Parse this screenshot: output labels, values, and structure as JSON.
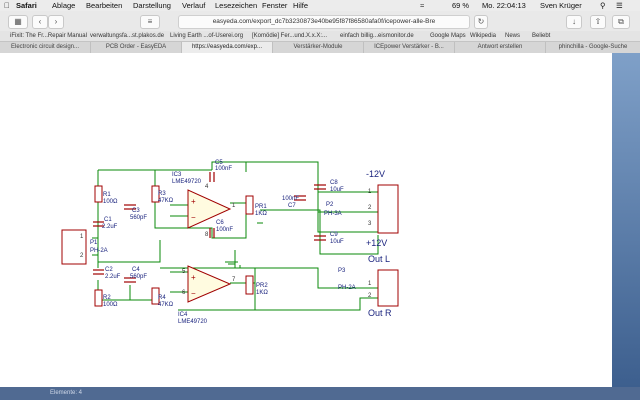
{
  "menubar": {
    "app": "Safari",
    "items": [
      "Ablage",
      "Bearbeiten",
      "Darstellung",
      "Verlauf",
      "Lesezeichen",
      "Fenster",
      "Hilfe"
    ],
    "battery": "69 %",
    "clock": "Mo. 22:04:13",
    "user": "Sven Krüger"
  },
  "toolbar": {
    "url": "easyeda.com/export_dc7b3230873e40be95f87f86580afa0f/icepower-alle-Bre"
  },
  "bookmarks": [
    "iFixit: The Fr...Repair Manual",
    "verwaltungsfa...st.plakos.de",
    "Living Earth ...of-Userei.org",
    "[Komödie] Fer...und.X.x.X:...",
    "einfach billig...eismonitor.de",
    "Google Maps",
    "Wikipedia",
    "News",
    "Beliebt"
  ],
  "tabs": [
    "Electronic circuit design...",
    "PCB Order - EasyEDA",
    "https://easyeda.com/exp...",
    "Verstärker-Module",
    "ICEpower Verstärker - B...",
    "Antwort erstellen",
    "phinchilla - Google-Suche"
  ],
  "schematic": {
    "r1": {
      "ref": "R1",
      "val": "100Ω"
    },
    "c1": {
      "ref": "C1",
      "val": "2.2uF"
    },
    "c3": {
      "ref": "C3",
      "val": "560pF"
    },
    "r3": {
      "ref": "R3",
      "val": "47KΩ"
    },
    "ic3": {
      "ref": "IC3",
      "val": "LME49720"
    },
    "c5": {
      "ref": "C5",
      "val": "100nF"
    },
    "c6": {
      "ref": "C6",
      "val": "100nF"
    },
    "pr1": {
      "ref": "PR1",
      "val": "1KΩ"
    },
    "c7": {
      "ref": "C7",
      "val": "100nF"
    },
    "c8": {
      "ref": "C8",
      "val": "10uF"
    },
    "c9": {
      "ref": "C9",
      "val": "10uF"
    },
    "p2": {
      "ref": "P2",
      "val": "PH-3A"
    },
    "p1": {
      "ref": "P1",
      "val": "PH-2A"
    },
    "c2": {
      "ref": "C2",
      "val": "2.2uF"
    },
    "c4": {
      "ref": "C4",
      "val": "560pF"
    },
    "r2": {
      "ref": "R2",
      "val": "100Ω"
    },
    "r4": {
      "ref": "R4",
      "val": "47KΩ"
    },
    "ic4": {
      "ref": "IC4",
      "val": "LME49720"
    },
    "pr2": {
      "ref": "PR2",
      "val": "1KΩ"
    },
    "p3": {
      "ref": "P3",
      "val": "PH-2A"
    },
    "labels": {
      "neg12": "-12V",
      "pos12": "+12V",
      "outl": "Out L",
      "outr": "Out R"
    },
    "pins": {
      "p1": "1",
      "p2": "2",
      "p3": "3",
      "p8": "8",
      "p4": "4",
      "p5": "5",
      "p6": "6",
      "p7": "7"
    }
  },
  "status": "Elemente: 4"
}
